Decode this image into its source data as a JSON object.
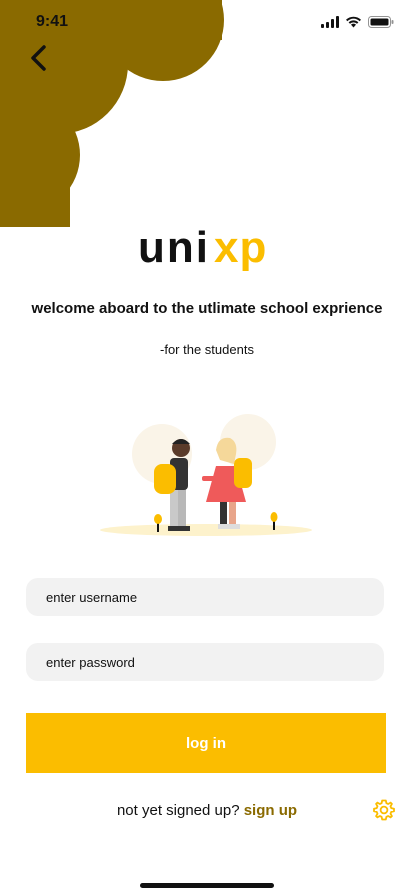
{
  "status_bar": {
    "time": "9:41"
  },
  "brand": {
    "logo_text_main": "uni",
    "logo_text_accent": "xp"
  },
  "header": {
    "tagline": "welcome aboard to the utlimate school exprience",
    "subtitle": "-for the students"
  },
  "form": {
    "username_placeholder": "enter username",
    "password_placeholder": "enter password",
    "login_label": "log in"
  },
  "footer": {
    "signup_prompt": "not yet signed up?",
    "signup_link": "sign up"
  },
  "colors": {
    "accent_yellow": "#fbbd00",
    "brand_olive": "#8a6a00",
    "field_bg": "#f2f2f2"
  },
  "icons": [
    "back-arrow-icon",
    "signal-icon",
    "wifi-icon",
    "battery-icon",
    "gear-icon"
  ]
}
